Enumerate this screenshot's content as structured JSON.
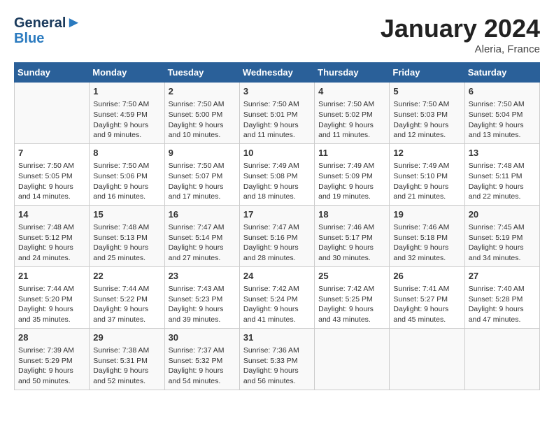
{
  "logo": {
    "line1": "General",
    "line2": "Blue"
  },
  "title": "January 2024",
  "location": "Aleria, France",
  "columns": [
    "Sunday",
    "Monday",
    "Tuesday",
    "Wednesday",
    "Thursday",
    "Friday",
    "Saturday"
  ],
  "weeks": [
    [
      {
        "day": "",
        "info": ""
      },
      {
        "day": "1",
        "info": "Sunrise: 7:50 AM\nSunset: 4:59 PM\nDaylight: 9 hours\nand 9 minutes."
      },
      {
        "day": "2",
        "info": "Sunrise: 7:50 AM\nSunset: 5:00 PM\nDaylight: 9 hours\nand 10 minutes."
      },
      {
        "day": "3",
        "info": "Sunrise: 7:50 AM\nSunset: 5:01 PM\nDaylight: 9 hours\nand 11 minutes."
      },
      {
        "day": "4",
        "info": "Sunrise: 7:50 AM\nSunset: 5:02 PM\nDaylight: 9 hours\nand 11 minutes."
      },
      {
        "day": "5",
        "info": "Sunrise: 7:50 AM\nSunset: 5:03 PM\nDaylight: 9 hours\nand 12 minutes."
      },
      {
        "day": "6",
        "info": "Sunrise: 7:50 AM\nSunset: 5:04 PM\nDaylight: 9 hours\nand 13 minutes."
      }
    ],
    [
      {
        "day": "7",
        "info": "Sunrise: 7:50 AM\nSunset: 5:05 PM\nDaylight: 9 hours\nand 14 minutes."
      },
      {
        "day": "8",
        "info": "Sunrise: 7:50 AM\nSunset: 5:06 PM\nDaylight: 9 hours\nand 16 minutes."
      },
      {
        "day": "9",
        "info": "Sunrise: 7:50 AM\nSunset: 5:07 PM\nDaylight: 9 hours\nand 17 minutes."
      },
      {
        "day": "10",
        "info": "Sunrise: 7:49 AM\nSunset: 5:08 PM\nDaylight: 9 hours\nand 18 minutes."
      },
      {
        "day": "11",
        "info": "Sunrise: 7:49 AM\nSunset: 5:09 PM\nDaylight: 9 hours\nand 19 minutes."
      },
      {
        "day": "12",
        "info": "Sunrise: 7:49 AM\nSunset: 5:10 PM\nDaylight: 9 hours\nand 21 minutes."
      },
      {
        "day": "13",
        "info": "Sunrise: 7:48 AM\nSunset: 5:11 PM\nDaylight: 9 hours\nand 22 minutes."
      }
    ],
    [
      {
        "day": "14",
        "info": "Sunrise: 7:48 AM\nSunset: 5:12 PM\nDaylight: 9 hours\nand 24 minutes."
      },
      {
        "day": "15",
        "info": "Sunrise: 7:48 AM\nSunset: 5:13 PM\nDaylight: 9 hours\nand 25 minutes."
      },
      {
        "day": "16",
        "info": "Sunrise: 7:47 AM\nSunset: 5:14 PM\nDaylight: 9 hours\nand 27 minutes."
      },
      {
        "day": "17",
        "info": "Sunrise: 7:47 AM\nSunset: 5:16 PM\nDaylight: 9 hours\nand 28 minutes."
      },
      {
        "day": "18",
        "info": "Sunrise: 7:46 AM\nSunset: 5:17 PM\nDaylight: 9 hours\nand 30 minutes."
      },
      {
        "day": "19",
        "info": "Sunrise: 7:46 AM\nSunset: 5:18 PM\nDaylight: 9 hours\nand 32 minutes."
      },
      {
        "day": "20",
        "info": "Sunrise: 7:45 AM\nSunset: 5:19 PM\nDaylight: 9 hours\nand 34 minutes."
      }
    ],
    [
      {
        "day": "21",
        "info": "Sunrise: 7:44 AM\nSunset: 5:20 PM\nDaylight: 9 hours\nand 35 minutes."
      },
      {
        "day": "22",
        "info": "Sunrise: 7:44 AM\nSunset: 5:22 PM\nDaylight: 9 hours\nand 37 minutes."
      },
      {
        "day": "23",
        "info": "Sunrise: 7:43 AM\nSunset: 5:23 PM\nDaylight: 9 hours\nand 39 minutes."
      },
      {
        "day": "24",
        "info": "Sunrise: 7:42 AM\nSunset: 5:24 PM\nDaylight: 9 hours\nand 41 minutes."
      },
      {
        "day": "25",
        "info": "Sunrise: 7:42 AM\nSunset: 5:25 PM\nDaylight: 9 hours\nand 43 minutes."
      },
      {
        "day": "26",
        "info": "Sunrise: 7:41 AM\nSunset: 5:27 PM\nDaylight: 9 hours\nand 45 minutes."
      },
      {
        "day": "27",
        "info": "Sunrise: 7:40 AM\nSunset: 5:28 PM\nDaylight: 9 hours\nand 47 minutes."
      }
    ],
    [
      {
        "day": "28",
        "info": "Sunrise: 7:39 AM\nSunset: 5:29 PM\nDaylight: 9 hours\nand 50 minutes."
      },
      {
        "day": "29",
        "info": "Sunrise: 7:38 AM\nSunset: 5:31 PM\nDaylight: 9 hours\nand 52 minutes."
      },
      {
        "day": "30",
        "info": "Sunrise: 7:37 AM\nSunset: 5:32 PM\nDaylight: 9 hours\nand 54 minutes."
      },
      {
        "day": "31",
        "info": "Sunrise: 7:36 AM\nSunset: 5:33 PM\nDaylight: 9 hours\nand 56 minutes."
      },
      {
        "day": "",
        "info": ""
      },
      {
        "day": "",
        "info": ""
      },
      {
        "day": "",
        "info": ""
      }
    ]
  ]
}
